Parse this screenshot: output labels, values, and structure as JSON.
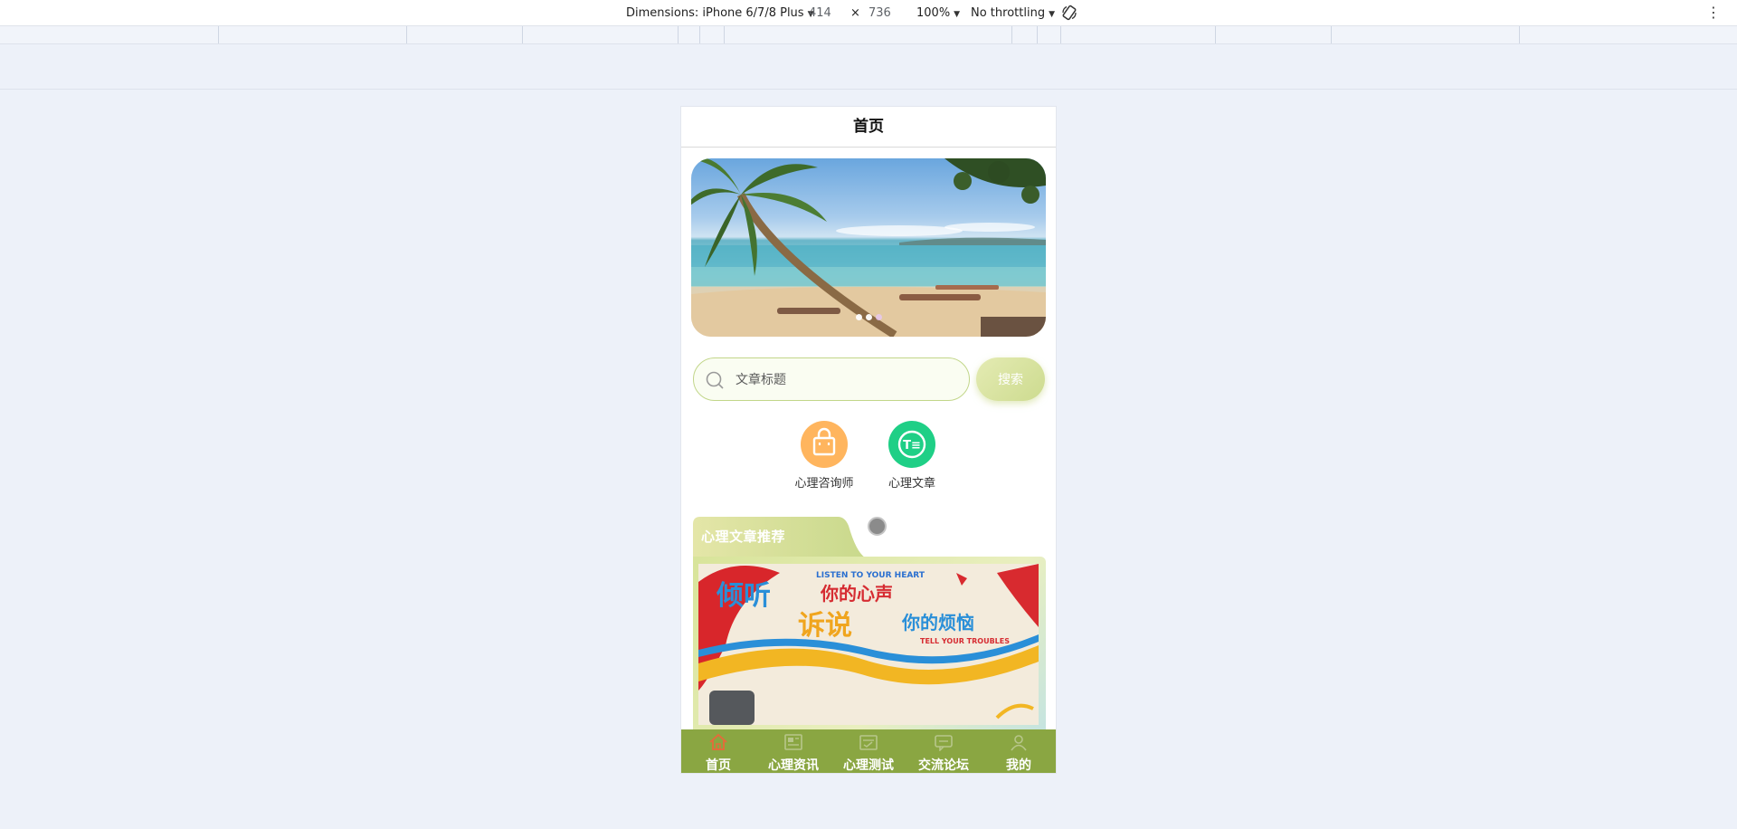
{
  "devtools": {
    "dimensions_label": "Dimensions: iPhone 6/7/8 Plus",
    "width": "414",
    "times": "×",
    "height": "736",
    "zoom": "100%",
    "throttling": "No throttling",
    "menu": "⋮"
  },
  "page": {
    "title": "首页"
  },
  "banner": {
    "slide_count": 3,
    "active_index": 0
  },
  "search": {
    "placeholder": "文章标题",
    "button_label": "搜索"
  },
  "entries": [
    {
      "label": "心理咨询师",
      "icon": "shopping-bag-icon",
      "color": "#ffb55e"
    },
    {
      "label": "心理文章",
      "icon": "article-icon",
      "color": "#1fcf86"
    }
  ],
  "recommendation": {
    "title": "心理文章推荐",
    "image_text_top": "LISTEN TO YOUR HEART",
    "image_text_main1": "倾听",
    "image_text_main2": "你的心声",
    "image_text_main3": "诉说",
    "image_text_main4": "你的烦恼",
    "image_text_bottom": "TELL YOUR TROUBLES"
  },
  "tabbar": {
    "background": "#8aa642",
    "active_color": "#e8693a",
    "items": [
      {
        "label": "首页",
        "icon": "home-icon",
        "active": true
      },
      {
        "label": "心理资讯",
        "icon": "news-icon",
        "active": false
      },
      {
        "label": "心理测试",
        "icon": "test-icon",
        "active": false
      },
      {
        "label": "交流论坛",
        "icon": "forum-icon",
        "active": false
      },
      {
        "label": "我的",
        "icon": "user-icon",
        "active": false
      }
    ]
  }
}
